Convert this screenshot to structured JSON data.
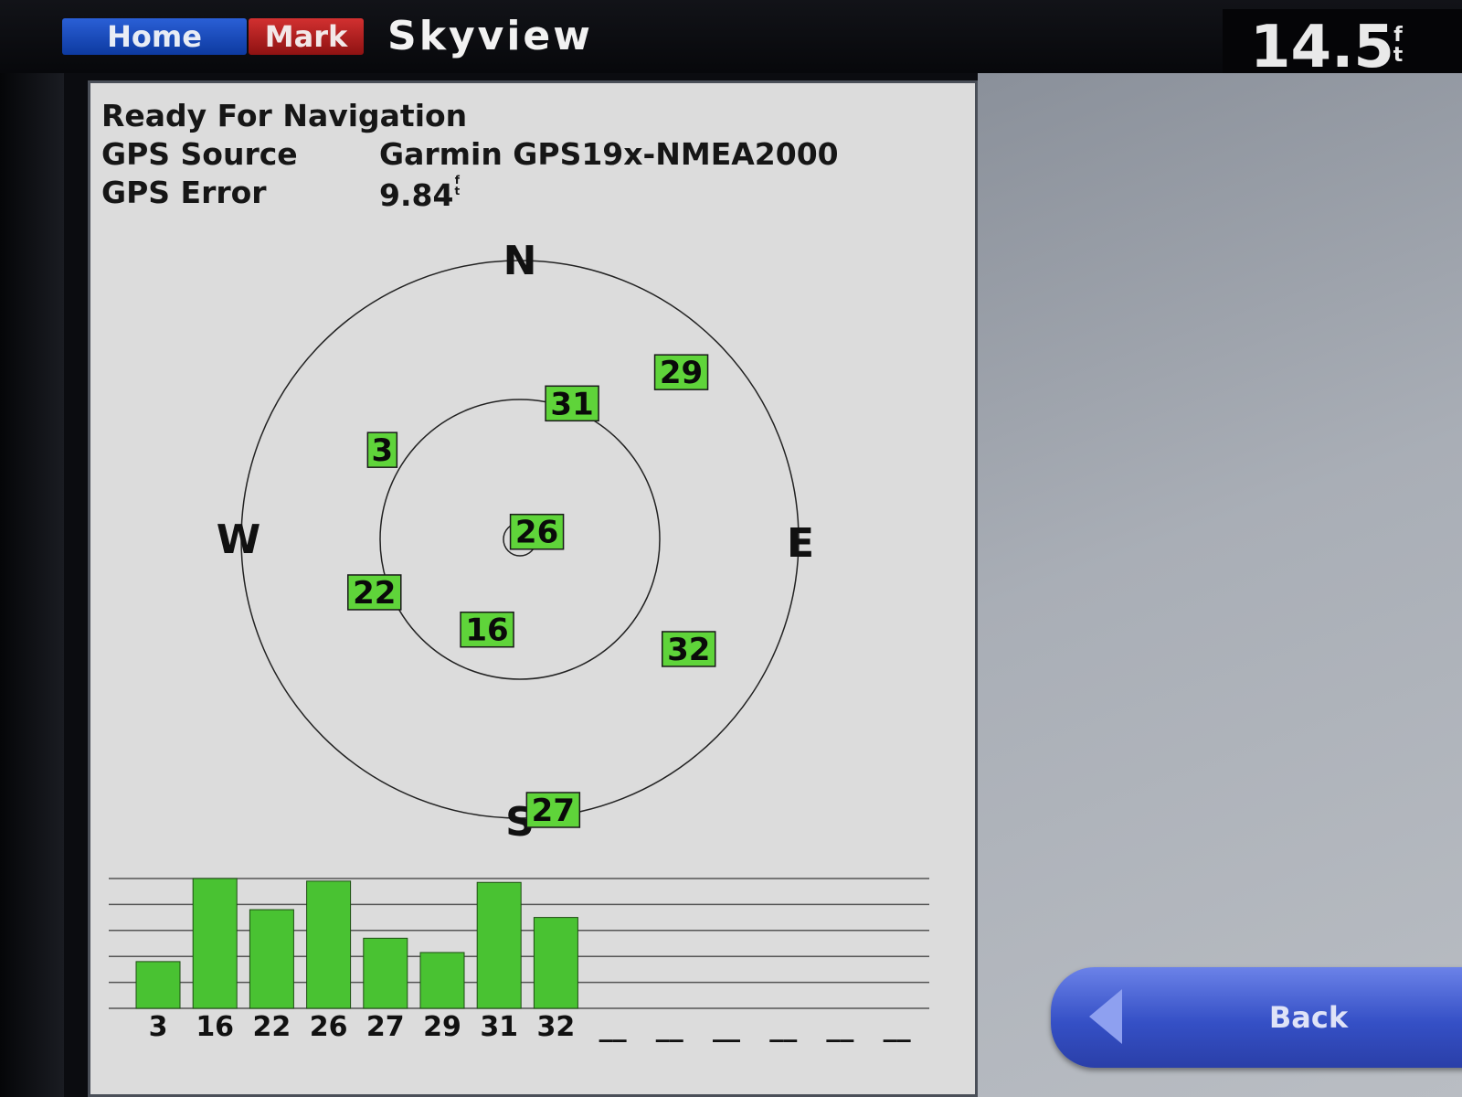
{
  "header": {
    "home_label": "Home",
    "mark_label": "Mark",
    "title": "Skyview",
    "depth_value": "14.5",
    "depth_unit": "ft"
  },
  "status": {
    "message": "Ready For Navigation",
    "gps_source_label": "GPS Source",
    "gps_source_value": "Garmin GPS19x-NMEA2000",
    "gps_error_label": "GPS Error",
    "gps_error_value": "9.84",
    "gps_error_unit": "ft"
  },
  "compass": {
    "north": "N",
    "south": "S",
    "east": "E",
    "west": "W"
  },
  "satellites": [
    {
      "id": "31",
      "azimuth_deg": 21,
      "elevation_deg": 43
    },
    {
      "id": "29",
      "azimuth_deg": 44,
      "elevation_deg": 15
    },
    {
      "id": "3",
      "azimuth_deg": 303,
      "elevation_deg": 37
    },
    {
      "id": "26",
      "azimuth_deg": 66,
      "elevation_deg": 84
    },
    {
      "id": "22",
      "azimuth_deg": 250,
      "elevation_deg": 40
    },
    {
      "id": "16",
      "azimuth_deg": 200,
      "elevation_deg": 59
    },
    {
      "id": "32",
      "azimuth_deg": 123,
      "elevation_deg": 25
    },
    {
      "id": "27",
      "azimuth_deg": 173,
      "elevation_deg": 2
    }
  ],
  "signal_bars": [
    {
      "id": "3",
      "strength": 0.36
    },
    {
      "id": "16",
      "strength": 1.0
    },
    {
      "id": "22",
      "strength": 0.76
    },
    {
      "id": "26",
      "strength": 0.98
    },
    {
      "id": "27",
      "strength": 0.54
    },
    {
      "id": "29",
      "strength": 0.43
    },
    {
      "id": "31",
      "strength": 0.97
    },
    {
      "id": "32",
      "strength": 0.7
    }
  ],
  "empty_slot_label": "__",
  "empty_slot_count": 6,
  "back_button": {
    "label": "Back"
  },
  "colors": {
    "satellite_fill": "#5fd43a",
    "bar_fill": "#49c232",
    "home_button": "#1f4fd0",
    "mark_button": "#c42424",
    "back_button": "#3550c6"
  }
}
